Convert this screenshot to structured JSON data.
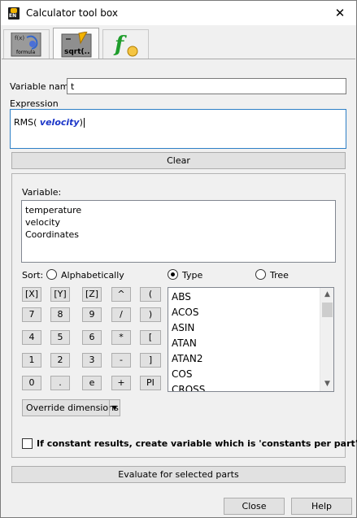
{
  "window": {
    "title": "Calculator tool box",
    "close_glyph": "✕"
  },
  "tabs": [
    {
      "name": "formula-tab",
      "icon": "formula-icon",
      "caption": "formula",
      "top_text": "f(x)"
    },
    {
      "name": "sqrt-tab",
      "icon": "sqrt-icon",
      "caption": "sqrt(.."
    },
    {
      "name": "function-tab",
      "icon": "function-fx-icon",
      "caption": "f"
    }
  ],
  "variable_name": {
    "label": "Variable name",
    "value": "t"
  },
  "expression": {
    "label": "Expression",
    "prefix": "RMS(",
    "var": "velocity",
    "suffix": ")"
  },
  "clear_label": "Clear",
  "variable_section": {
    "label": "Variable:",
    "items": [
      "temperature",
      "velocity",
      "Coordinates"
    ]
  },
  "sort": {
    "label": "Sort:",
    "options": [
      "Alphabetically",
      "Type",
      "Tree"
    ],
    "selected": "Type"
  },
  "keypad": [
    [
      "[X]",
      "[Y]",
      "[Z]",
      "^",
      "("
    ],
    [
      "7",
      "8",
      "9",
      "/",
      ")"
    ],
    [
      "4",
      "5",
      "6",
      "*",
      "["
    ],
    [
      "1",
      "2",
      "3",
      "-",
      "]"
    ],
    [
      "0",
      ".",
      "e",
      "+",
      "PI"
    ]
  ],
  "functions": [
    "ABS",
    "ACOS",
    "ASIN",
    "ATAN",
    "ATAN2",
    "COS",
    "CROSS"
  ],
  "override_label": "Override dimensions",
  "constant_check_label": "If constant results, create variable which is 'constants per part'",
  "evaluate_label": "Evaluate for selected parts",
  "close_label": "Close",
  "help_label": "Help"
}
